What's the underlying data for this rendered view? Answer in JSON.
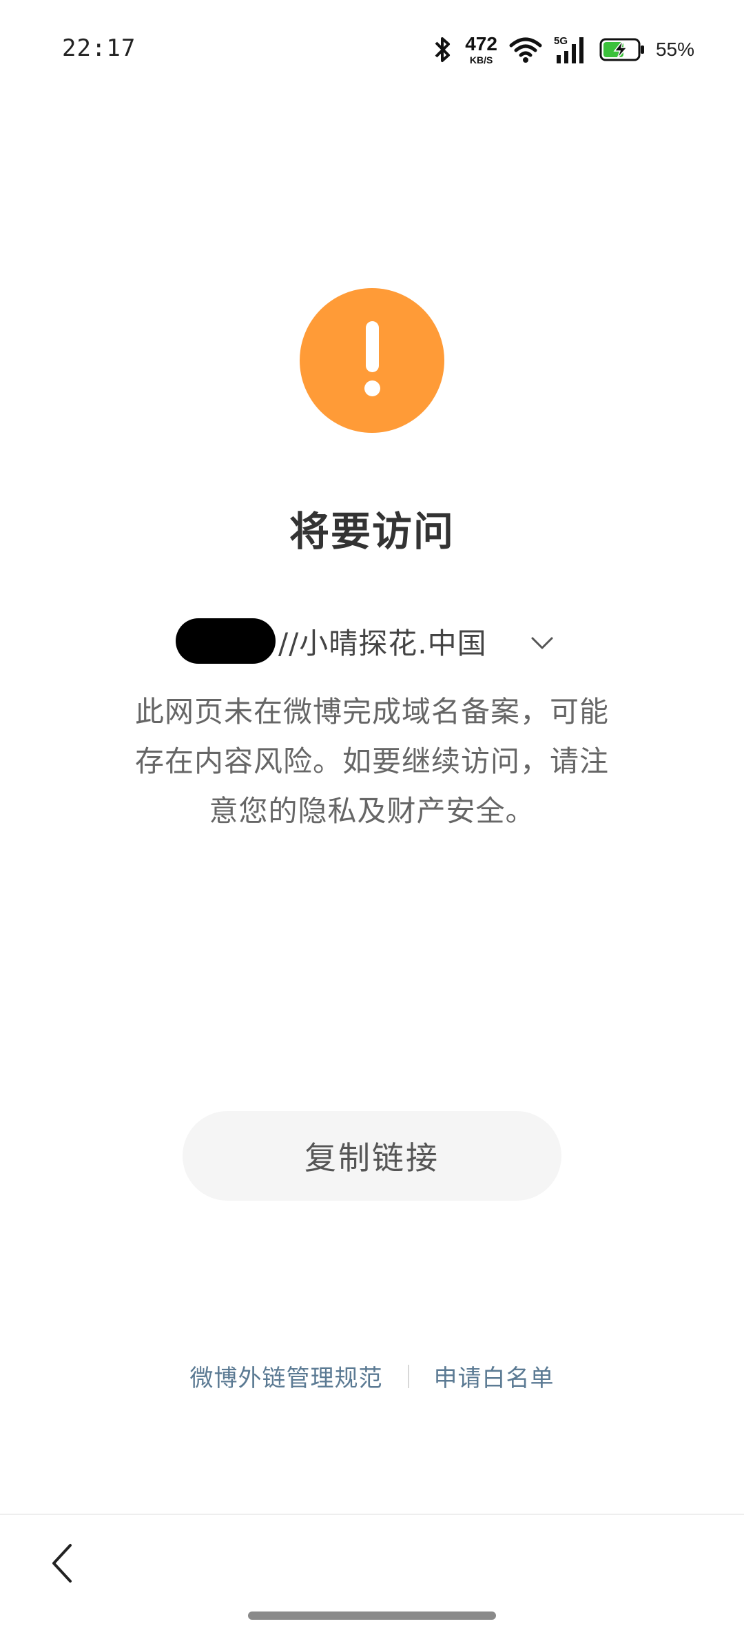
{
  "status_bar": {
    "time": "22:17",
    "net_speed_value": "472",
    "net_speed_unit": "KB/S",
    "network_type": "5G",
    "battery_percent": "55%",
    "icons": [
      "bluetooth-icon",
      "wifi-icon",
      "cellular-signal-icon",
      "battery-charging-icon"
    ]
  },
  "warning": {
    "icon": "warning-exclamation-icon",
    "color": "#ff9b37"
  },
  "title": "将要访问",
  "url": {
    "text": "//小晴探花.中国",
    "expand_icon": "chevron-down-icon"
  },
  "description": {
    "line1": "此网页未在微博完成域名备案，可能",
    "line2": "存在内容风险。如要继续访问，请注",
    "line3": "意您的隐私及财产安全。"
  },
  "actions": {
    "copy_link_label": "复制链接"
  },
  "footer": {
    "link_rules": "微博外链管理规范",
    "link_whitelist": "申请白名单",
    "link_color": "#5b7a93"
  },
  "nav": {
    "back_icon": "back-arrow-icon"
  }
}
